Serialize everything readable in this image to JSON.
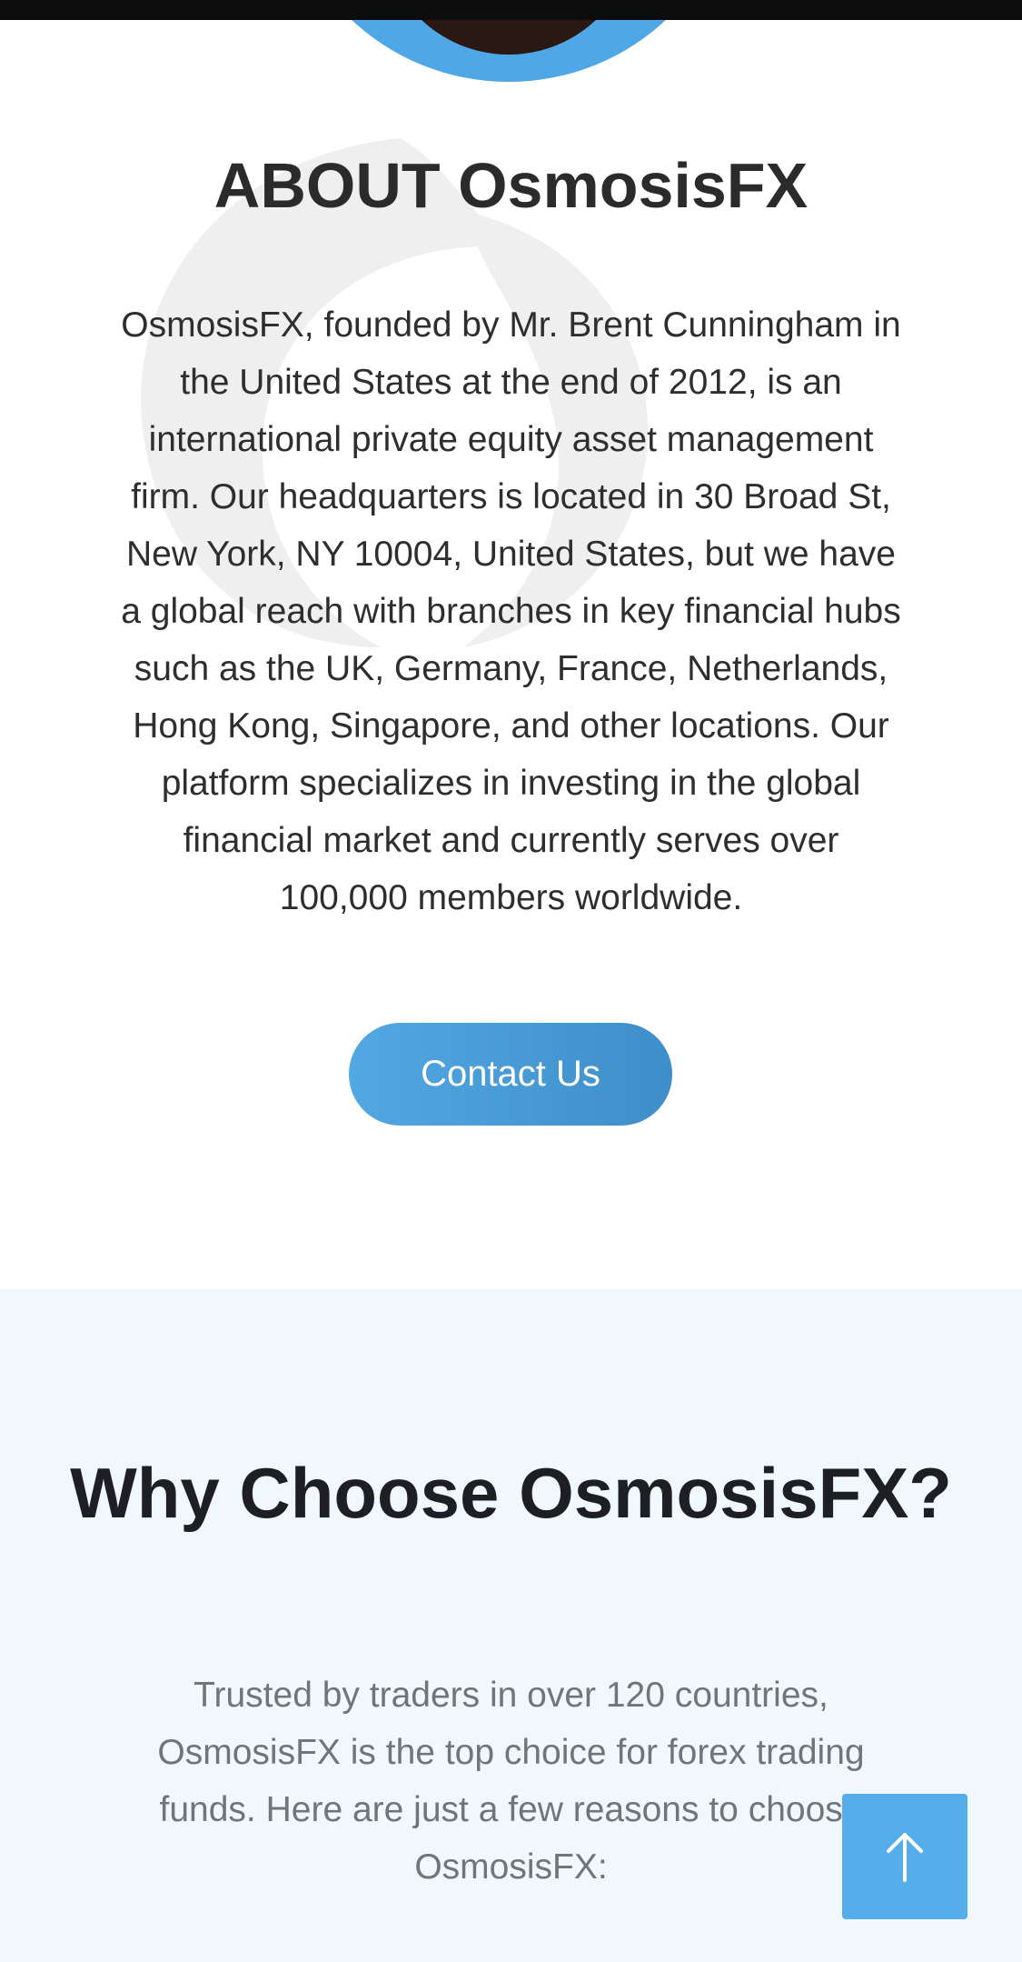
{
  "about": {
    "title": "ABOUT OsmosisFX",
    "body": "OsmosisFX, founded by Mr. Brent Cunningham in the United States at the end of 2012, is an international private equity asset management firm. Our headquarters is located in 30 Broad St, New York, NY 10004, United States, but we have a global reach with branches in key financial hubs such as the UK, Germany, France, Netherlands, Hong Kong, Singapore, and other locations. Our platform specializes in investing in the global financial market and currently serves over 100,000 members worldwide.",
    "contact_label": "Contact Us"
  },
  "why": {
    "title": "Why Choose OsmosisFX?",
    "body": "Trusted by traders in over 120 countries, OsmosisFX is the top choice for forex trading funds. Here are just a few reasons to choose OsmosisFX:"
  },
  "icons": {
    "scroll_top": "arrow-up-icon",
    "avatar": "profile-photo"
  },
  "colors": {
    "accent": "#4fa7e6",
    "button_start": "#52a8e3",
    "button_end": "#3e8ec9",
    "section_alt_bg": "#f0f7fd",
    "heading": "#2b2b2b",
    "muted_text": "#70757a"
  }
}
